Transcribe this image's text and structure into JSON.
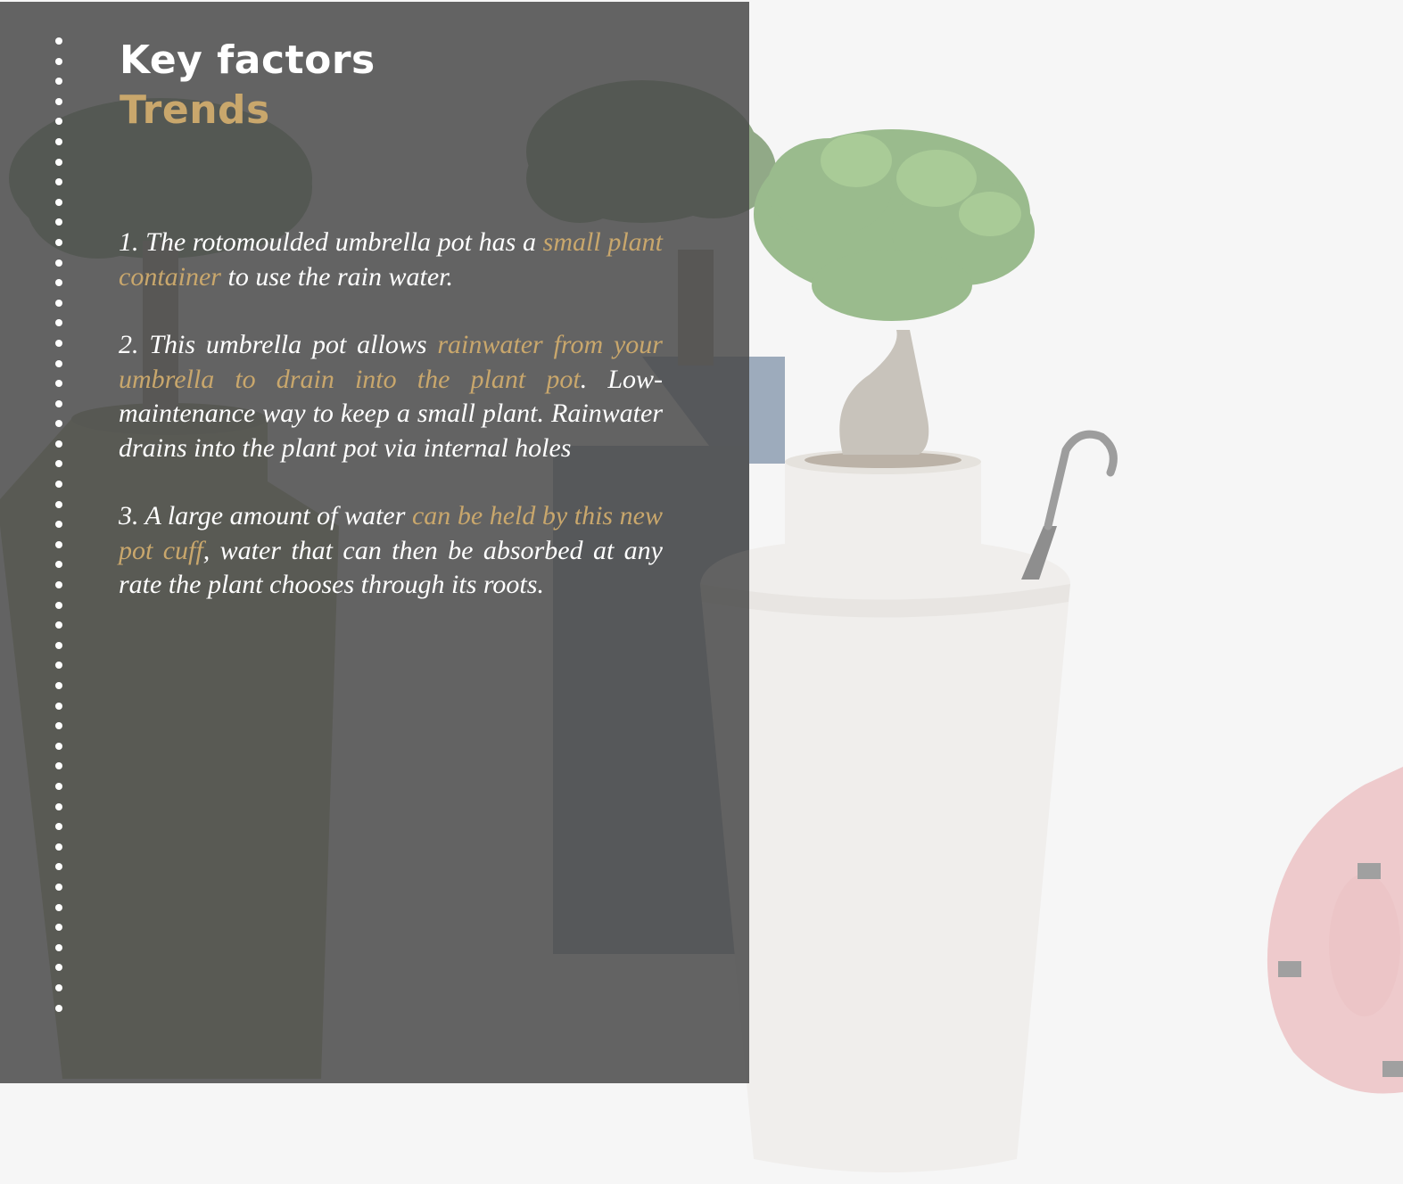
{
  "slide": {
    "title": "Key factors",
    "subtitle": "Trends",
    "paragraphs": [
      {
        "p1": "1. The rotomoulded umbrella pot has a ",
        "h1": "small plant container",
        "p2": " to use the rain water.",
        "h2": "",
        "p3": ""
      },
      {
        "p1": "2. This umbrella pot allows ",
        "h1": "rainwater from your umbrella to drain into the plant pot",
        "p2": ". Low-maintenance way to keep a small plant. Rainwater drains into the plant pot via internal holes",
        "h2": "",
        "p3": ""
      },
      {
        "p1": "3. A large amount of water ",
        "h1": "can be held by this new pot cuff",
        "p2": ", water that can then be absorbed at any rate the plant chooses through its roots.",
        "h2": "",
        "p3": ""
      }
    ]
  },
  "colors": {
    "accent": "#c9a76c",
    "panel": "#4a4a4a",
    "background": "#f6f6f6",
    "pot_white": "#ebe8e4",
    "pot_blue": "#4a5c72",
    "pot_olive": "#6f7a3a",
    "pot_pink": "#e8a6a9"
  },
  "icons": {
    "dots": "vertical-dotted-line-icon"
  }
}
